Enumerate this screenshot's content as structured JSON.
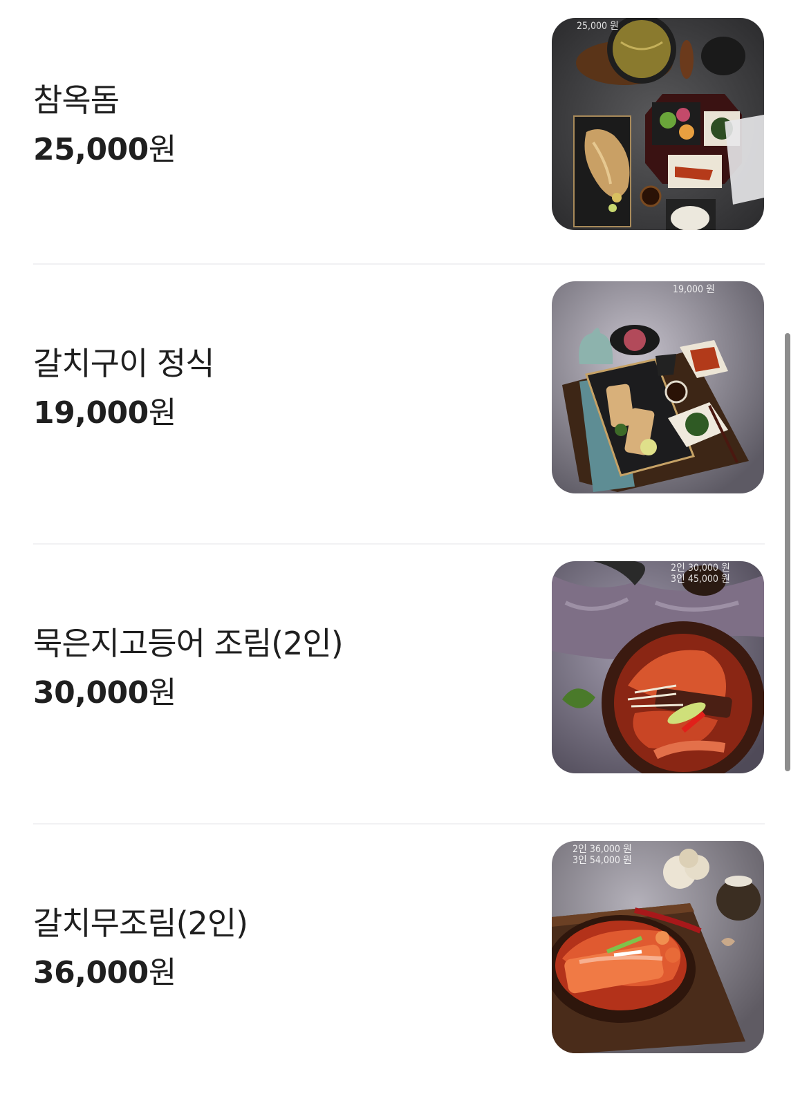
{
  "menu": {
    "items": [
      {
        "name": "참옥돔",
        "price": "25,000",
        "unit": "원",
        "image_label": "25,000 원"
      },
      {
        "name": "갈치구이 정식",
        "price": "19,000",
        "unit": "원",
        "image_label": "19,000 원"
      },
      {
        "name": "묵은지고등어 조림(2인)",
        "price": "30,000",
        "unit": "원",
        "image_label": "2인 30,000 원\n3인 45,000 원"
      },
      {
        "name": "갈치무조림(2인)",
        "price": "36,000",
        "unit": "원",
        "image_label": "2인 36,000 원\n3인 54,000 원"
      }
    ]
  },
  "colors": {
    "text": "#1f1f1f",
    "divider": "#f1f1f3",
    "scrollbar": "#8d8d8d"
  }
}
